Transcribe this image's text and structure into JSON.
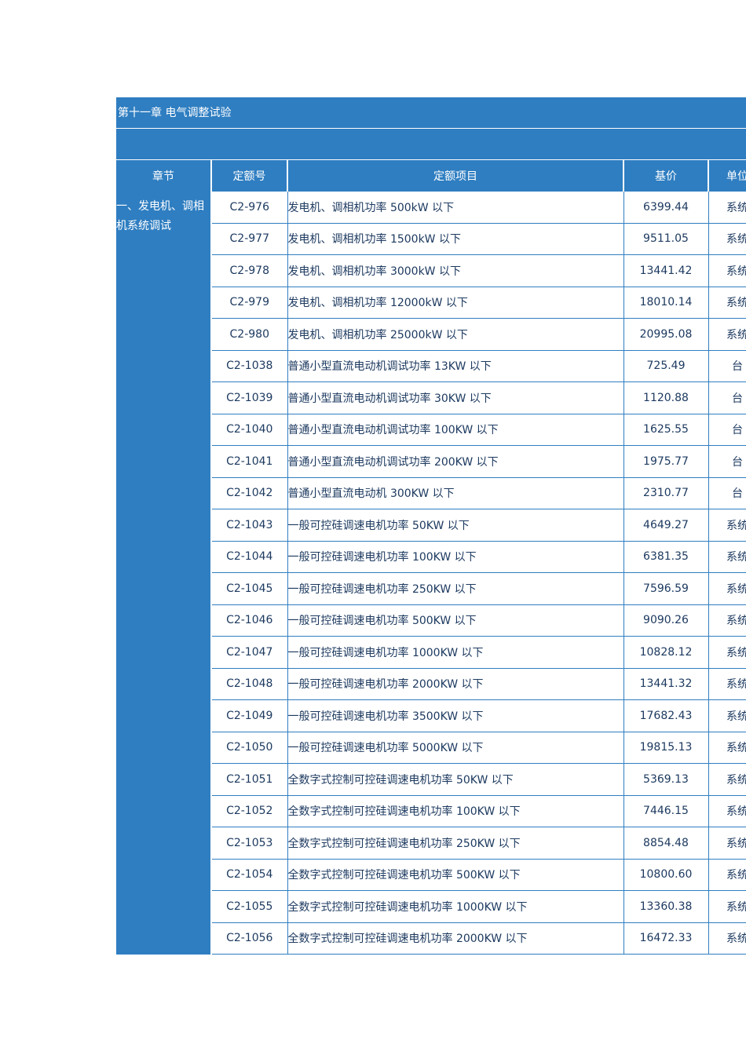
{
  "chapter_title": "第十一章 电气调整试验",
  "headers": {
    "section": "章节",
    "code": "定额号",
    "item": "定额项目",
    "price": "基价",
    "unit": "单位"
  },
  "section_name": "一、发电机、调相机系统调试",
  "rows": [
    {
      "code": "C2-976",
      "item": "发电机、调相机功率 500kW 以下",
      "price": "6399.44",
      "unit": "系统"
    },
    {
      "code": "C2-977",
      "item": "发电机、调相机功率 1500kW 以下",
      "price": "9511.05",
      "unit": "系统"
    },
    {
      "code": "C2-978",
      "item": "发电机、调相机功率 3000kW 以下",
      "price": "13441.42",
      "unit": "系统"
    },
    {
      "code": "C2-979",
      "item": "发电机、调相机功率 12000kW 以下",
      "price": "18010.14",
      "unit": "系统"
    },
    {
      "code": "C2-980",
      "item": "发电机、调相机功率 25000kW 以下",
      "price": "20995.08",
      "unit": "系统"
    },
    {
      "code": "C2-1038",
      "item": "普通小型直流电动机调试功率 13KW 以下",
      "price": "725.49",
      "unit": "台"
    },
    {
      "code": "C2-1039",
      "item": "普通小型直流电动机调试功率 30KW 以下",
      "price": "1120.88",
      "unit": "台"
    },
    {
      "code": "C2-1040",
      "item": "普通小型直流电动机调试功率 100KW 以下",
      "price": "1625.55",
      "unit": "台"
    },
    {
      "code": "C2-1041",
      "item": "普通小型直流电动机调试功率 200KW 以下",
      "price": "1975.77",
      "unit": "台"
    },
    {
      "code": "C2-1042",
      "item": "普通小型直流电动机 300KW  以下",
      "price": "2310.77",
      "unit": "台"
    },
    {
      "code": "C2-1043",
      "item": "一般可控硅调速电机功率 50KW 以下",
      "price": "4649.27",
      "unit": "系统"
    },
    {
      "code": "C2-1044",
      "item": "一般可控硅调速电机功率 100KW 以下",
      "price": "6381.35",
      "unit": "系统"
    },
    {
      "code": "C2-1045",
      "item": "一般可控硅调速电机功率 250KW 以下",
      "price": "7596.59",
      "unit": "系统"
    },
    {
      "code": "C2-1046",
      "item": "一般可控硅调速电机功率 500KW 以下",
      "price": "9090.26",
      "unit": "系统"
    },
    {
      "code": "C2-1047",
      "item": "一般可控硅调速电机功率 1000KW 以下",
      "price": "10828.12",
      "unit": "系统"
    },
    {
      "code": "C2-1048",
      "item": "一般可控硅调速电机功率 2000KW 以下",
      "price": "13441.32",
      "unit": "系统"
    },
    {
      "code": "C2-1049",
      "item": "一般可控硅调速电机功率 3500KW 以下",
      "price": "17682.43",
      "unit": "系统"
    },
    {
      "code": "C2-1050",
      "item": "一般可控硅调速电机功率 5000KW 以下",
      "price": "19815.13",
      "unit": "系统"
    },
    {
      "code": "C2-1051",
      "item": "全数字式控制可控硅调速电机功率 50KW 以下",
      "price": "5369.13",
      "unit": "系统"
    },
    {
      "code": "C2-1052",
      "item": "全数字式控制可控硅调速电机功率 100KW 以下",
      "price": "7446.15",
      "unit": "系统"
    },
    {
      "code": "C2-1053",
      "item": "全数字式控制可控硅调速电机功率 250KW 以下",
      "price": "8854.48",
      "unit": "系统"
    },
    {
      "code": "C2-1054",
      "item": "全数字式控制可控硅调速电机功率 500KW 以下",
      "price": "10800.60",
      "unit": "系统"
    },
    {
      "code": "C2-1055",
      "item": "全数字式控制可控硅调速电机功率 1000KW 以下",
      "price": "13360.38",
      "unit": "系统"
    },
    {
      "code": "C2-1056",
      "item": "全数字式控制可控硅调速电机功率 2000KW 以下",
      "price": "16472.33",
      "unit": "系统"
    }
  ],
  "colors": {
    "header_bg": "#2f7ec1",
    "text": "#1d3a60",
    "border": "#2f7ec1"
  }
}
